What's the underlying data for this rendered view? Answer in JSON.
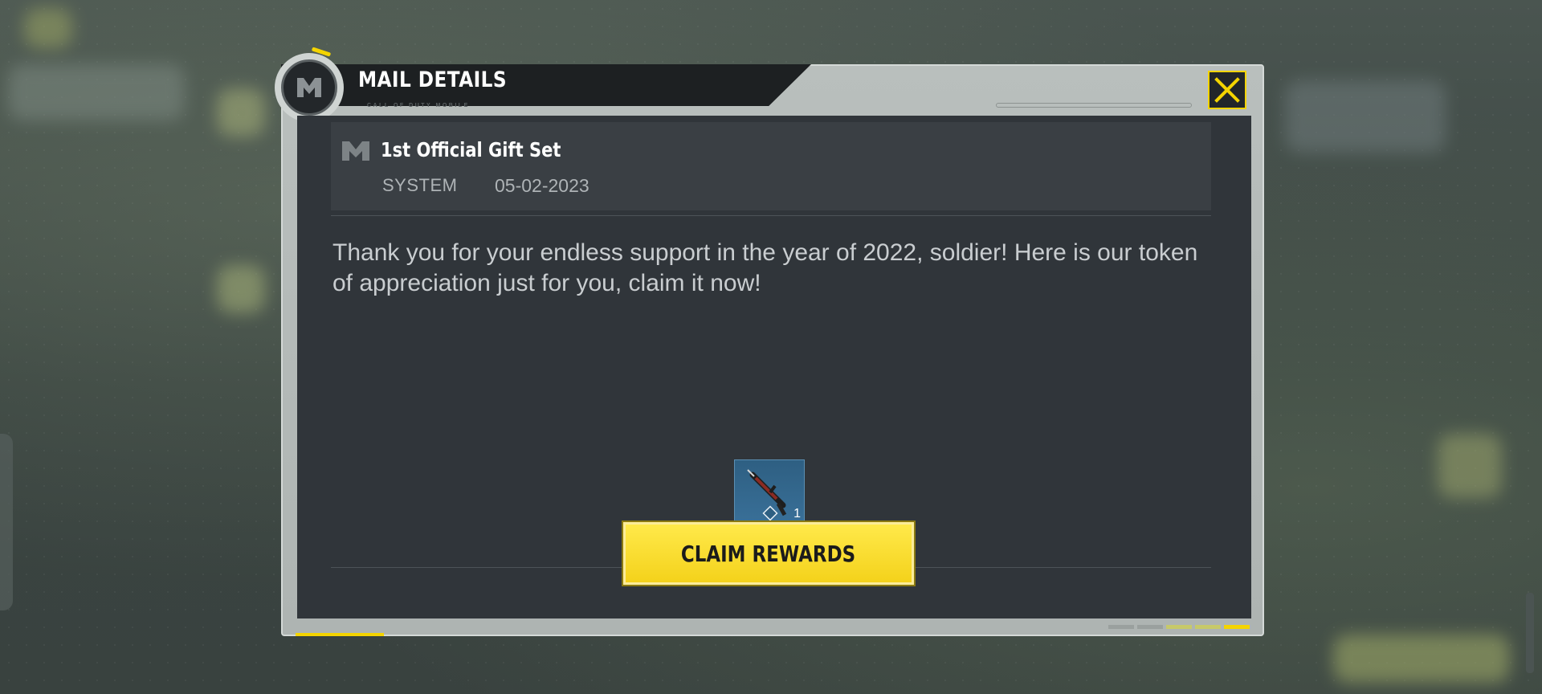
{
  "header": {
    "title": "MAIL DETAILS",
    "subtitle": "CALL OF DUTY MOBILE",
    "close_icon": "close-x-icon"
  },
  "mail": {
    "title": "1st Official Gift Set",
    "sender": "SYSTEM",
    "date": "05-02-2023",
    "body": "Thank you for your endless support in the year of 2022, soldier! Here is our token of appreciation just for you, claim it now!"
  },
  "rewards": [
    {
      "icon": "rifle-icon",
      "quantity": "1"
    }
  ],
  "actions": {
    "claim_label": "CLAIM REWARDS"
  },
  "colors": {
    "accent": "#f4d400",
    "panel": "#30353a",
    "frame": "#b9bfbd"
  }
}
